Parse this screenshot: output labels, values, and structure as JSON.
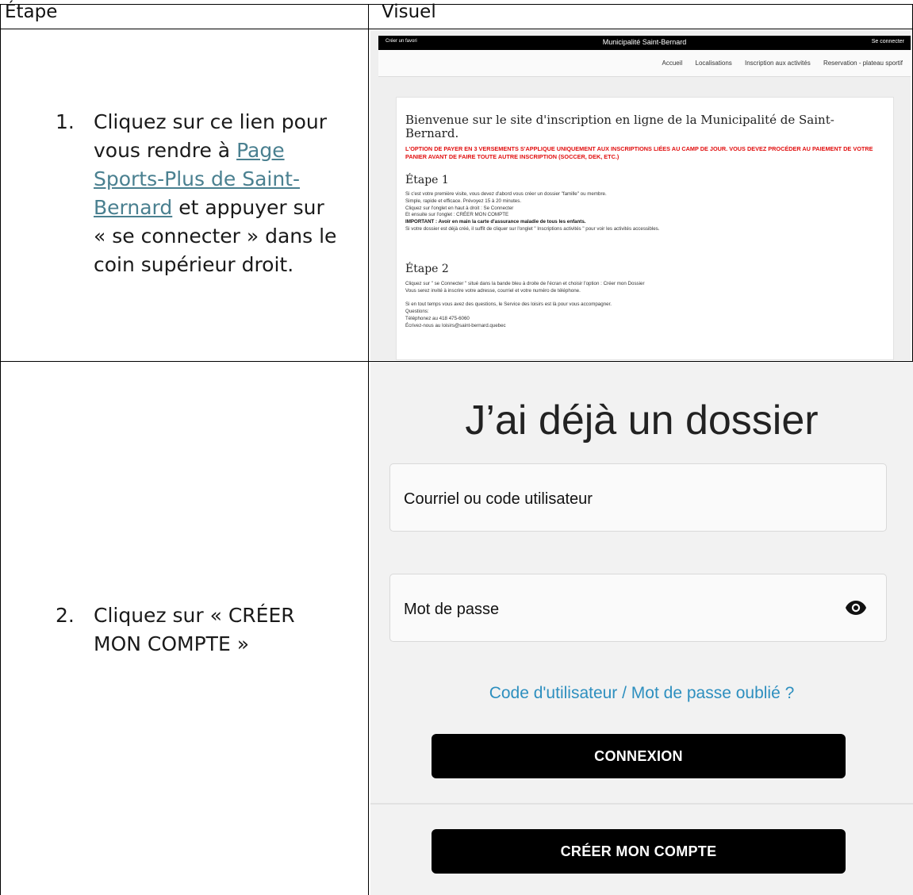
{
  "table": {
    "header": {
      "step": "Étape",
      "visual": "Visuel"
    }
  },
  "step1": {
    "number": "1.",
    "line1": "Cliquez sur ce lien pour",
    "line2_pre": "vous rendre à ",
    "link_line1": "Page",
    "link_line2": "Sports-Plus de Saint-",
    "link_line3": "Bernard",
    "line4_post": " et appuyer sur",
    "line5": "« se connecter » dans le",
    "line6": "coin supérieur droit."
  },
  "step2": {
    "number": "2.",
    "line1": "Cliquez sur « CRÉER",
    "line2": "MON COMPTE »"
  },
  "website": {
    "topbar": {
      "favorite": "Créer un favori",
      "title": "Municipalité Saint-Bernard",
      "login": "Se connecter"
    },
    "nav": [
      "Accueil",
      "Localisations",
      "Inscription aux activités",
      "Reservation - plateau sportif"
    ],
    "welcome": "Bienvenue sur le site d'inscription en ligne de la Municipalité de Saint-Bernard.",
    "warning": "L'OPTION DE PAYER EN 3 VERSEMENTS S'APPLIQUE UNIQUEMENT AUX INSCRIPTIONS LIÉES AU CAMP DE JOUR. VOUS DEVEZ PROCÉDER AU PAIEMENT DE VOTRE PANIER AVANT DE FAIRE TOUTE AUTRE INSCRIPTION (SOCCER, DEK, ETC.)",
    "etape1_title": "Étape 1",
    "etape1_lines": [
      "Si c'est votre première visite, vous devez d'abord vous créer un dossier \"famille\" ou membre.",
      "Simple, rapide et efficace. Prévoyez 15 à 20 minutes.",
      "Cliquez sur l'onglet en haut à droit : Se Connecter",
      "Et ensuite sur l'onglet : CRÉER MON COMPTE",
      "IMPORTANT : Avoir en main la carte d'assurance maladie de tous les enfants.",
      "Si votre dossier est déjà créé, il suffit de cliquer sur l'onglet \" Inscriptions activités \" pour voir les activités accessibles."
    ],
    "etape2_title": "Étape 2",
    "etape2_lines": [
      "Cliquez sur \" se Connecter \" situé dans la bande bleu à droite de l'écran et choisir l'option : Créer mon Dossier",
      "Vous serez invité à inscrire votre adresse, courriel et votre numéro de téléphone.",
      "",
      "Si en tout temps vous avez des questions, le Service des loisirs est là pour vous accompagner.",
      "Questions:",
      "Téléphonez au 418 475-6060",
      "Écrivez-nous au loisirs@saint-bernard.quebec"
    ]
  },
  "login": {
    "title": "J’ai déjà un dossier",
    "email_label": "Courriel ou code utilisateur",
    "password_label": "Mot de passe",
    "show_password_icon": "eye-icon",
    "forgot": "Code d'utilisateur / Mot de passe oublié ?",
    "connect_button": "CONNEXION",
    "create_button": "CRÉER MON COMPTE"
  }
}
